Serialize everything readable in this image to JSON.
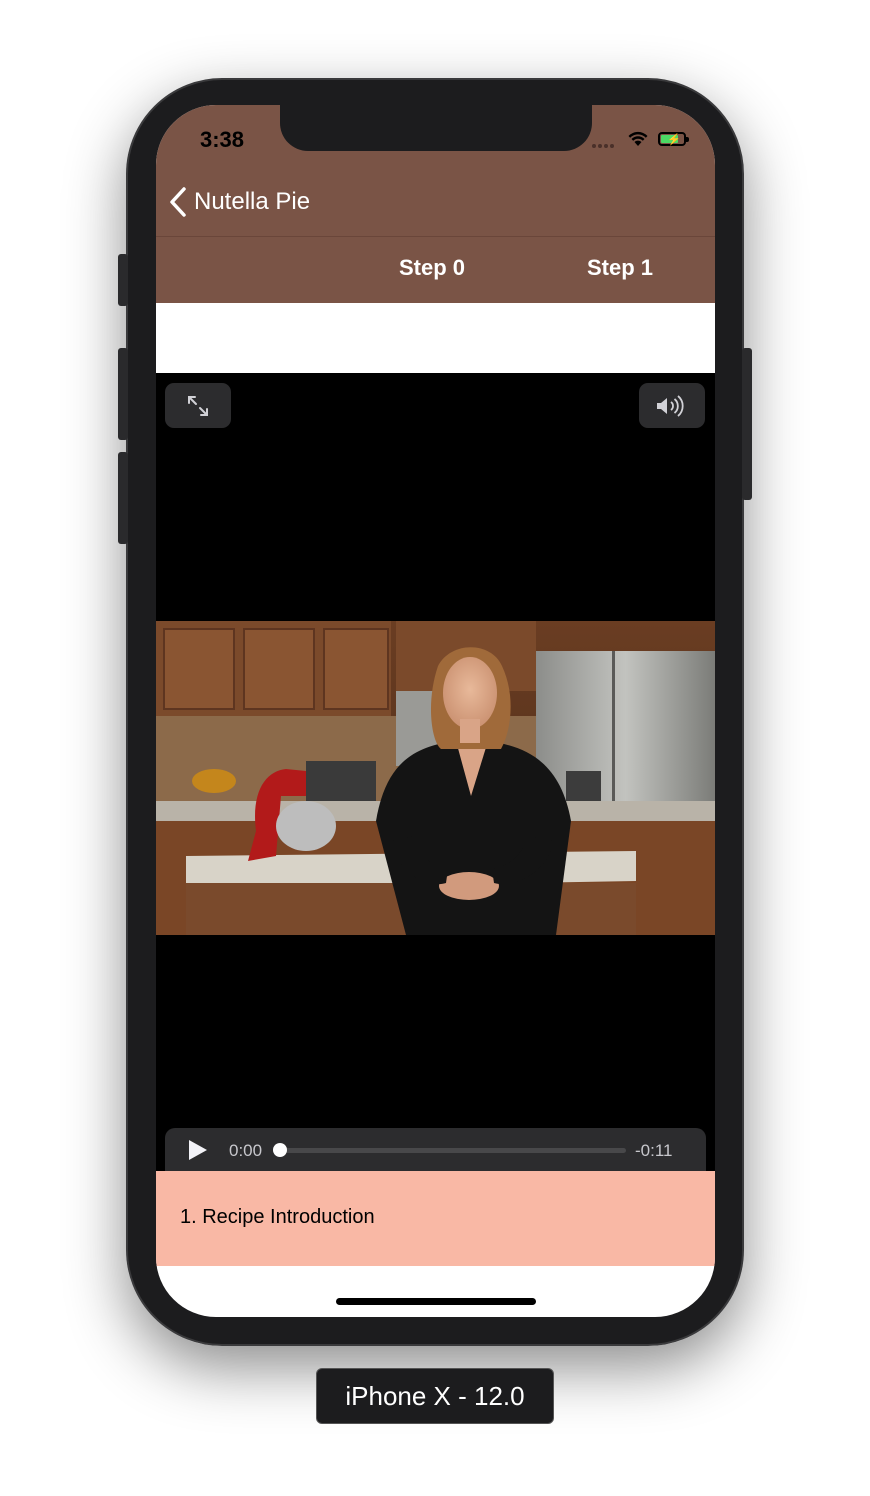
{
  "status_bar": {
    "time": "3:38"
  },
  "navbar": {
    "back_label": "Nutella Pie"
  },
  "tabs": [
    {
      "label": "Step 0"
    },
    {
      "label": "Step 1"
    }
  ],
  "player": {
    "current_time": "0:00",
    "remaining_time": "-0:11",
    "progress": 0.0
  },
  "step_list": [
    {
      "label": "1. Recipe Introduction"
    }
  ],
  "device_label": "iPhone X - 12.0",
  "colors": {
    "navbar": "#7a5446",
    "selected_step": "#f9b8a5",
    "player_bg": "#000000"
  },
  "icons": [
    "chevron-left-icon",
    "wifi-icon",
    "battery-icon",
    "fullscreen-icon",
    "volume-icon",
    "play-icon"
  ]
}
